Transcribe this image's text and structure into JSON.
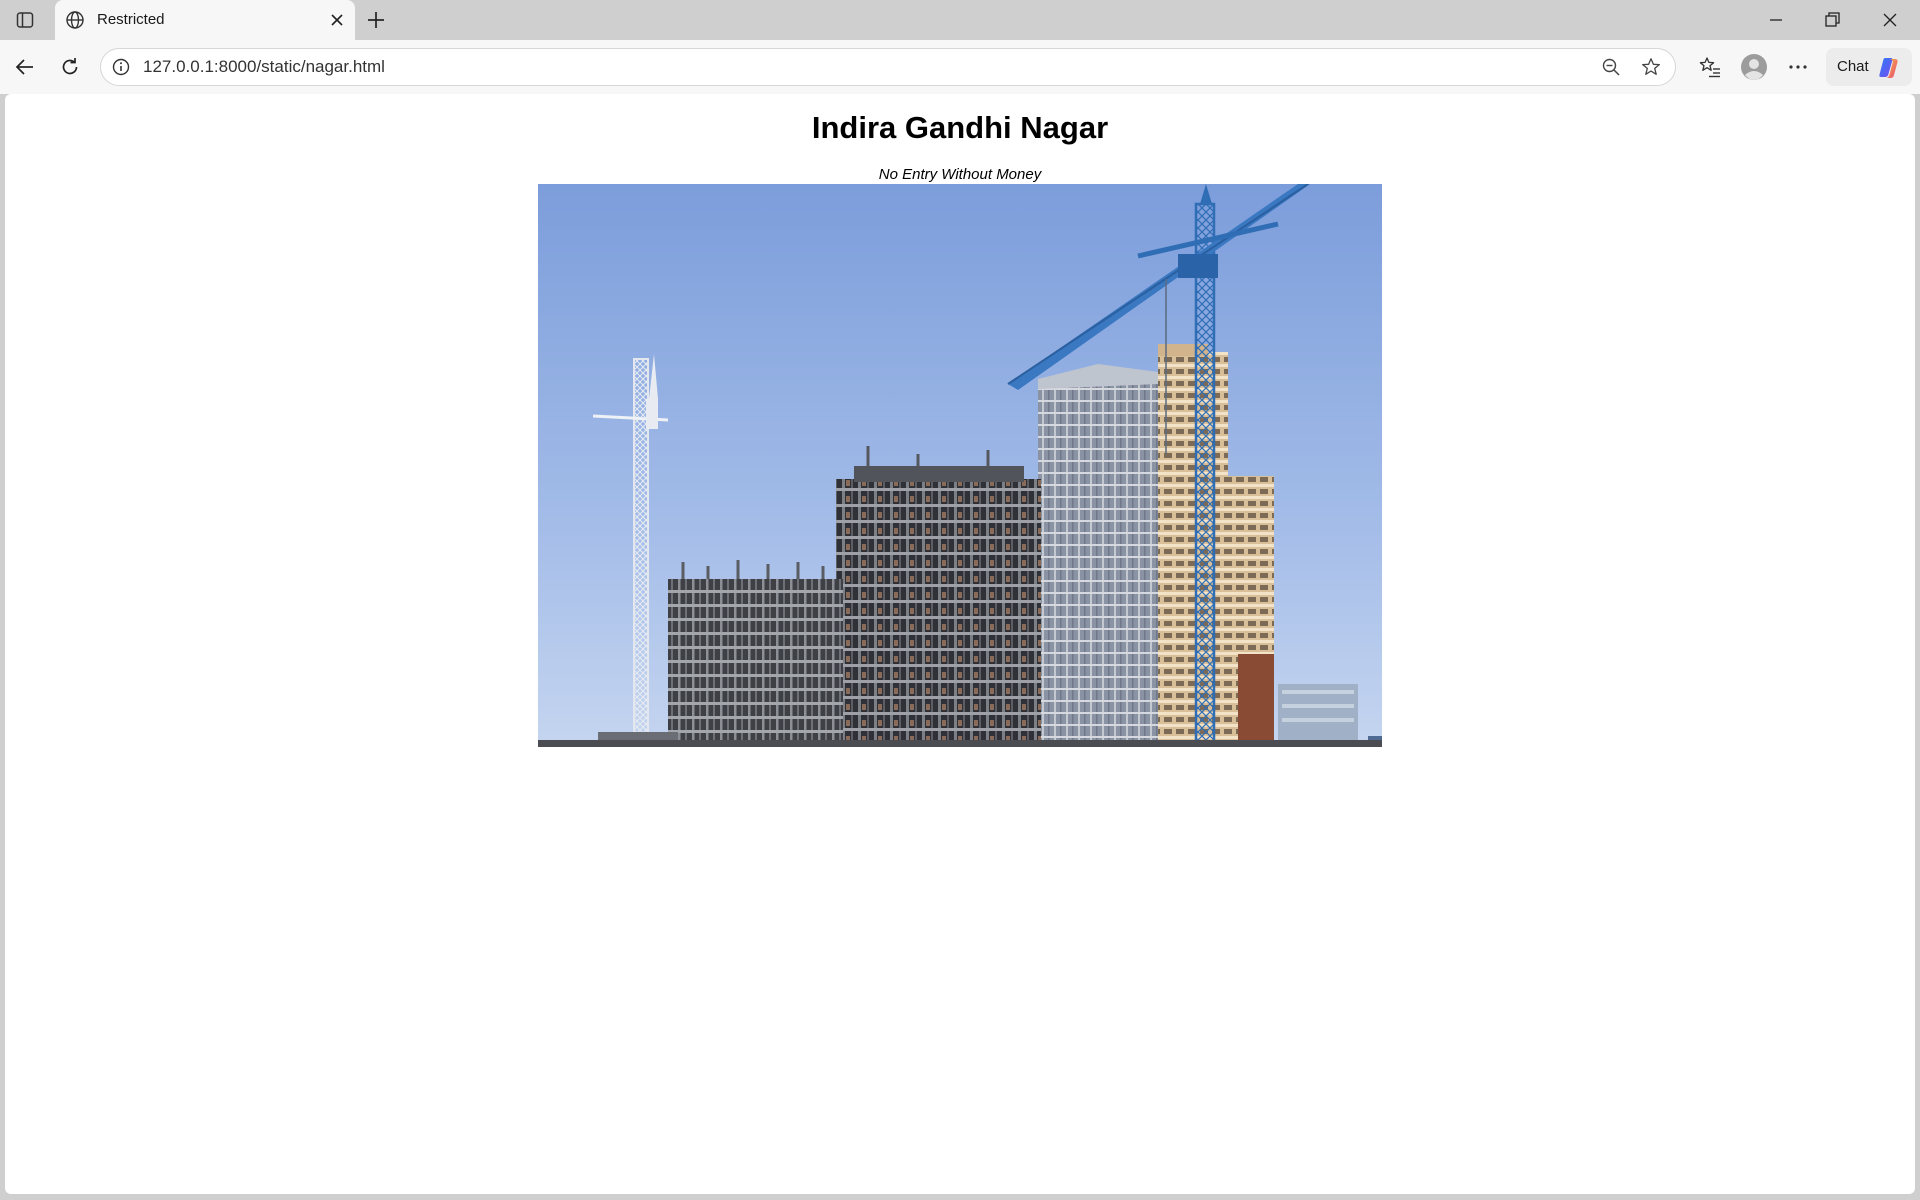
{
  "browser": {
    "tab": {
      "title": "Restricted",
      "icon": "globe-icon"
    },
    "address_bar": {
      "url": "127.0.0.1:8000/static/nagar.html"
    },
    "chat_button_label": "Chat"
  },
  "page": {
    "title": "Indira Gandhi Nagar",
    "subtitle": "No Entry Without Money",
    "image": {
      "subject": "buildings under construction with tower cranes against a blue sky"
    }
  },
  "colors": {
    "tabstrip_bg": "#cfcfcf",
    "toolbar_bg": "#f7f7f7",
    "page_bg": "#ffffff",
    "sky_top": "#7fa0db",
    "crane_blue": "#2f6db5"
  }
}
